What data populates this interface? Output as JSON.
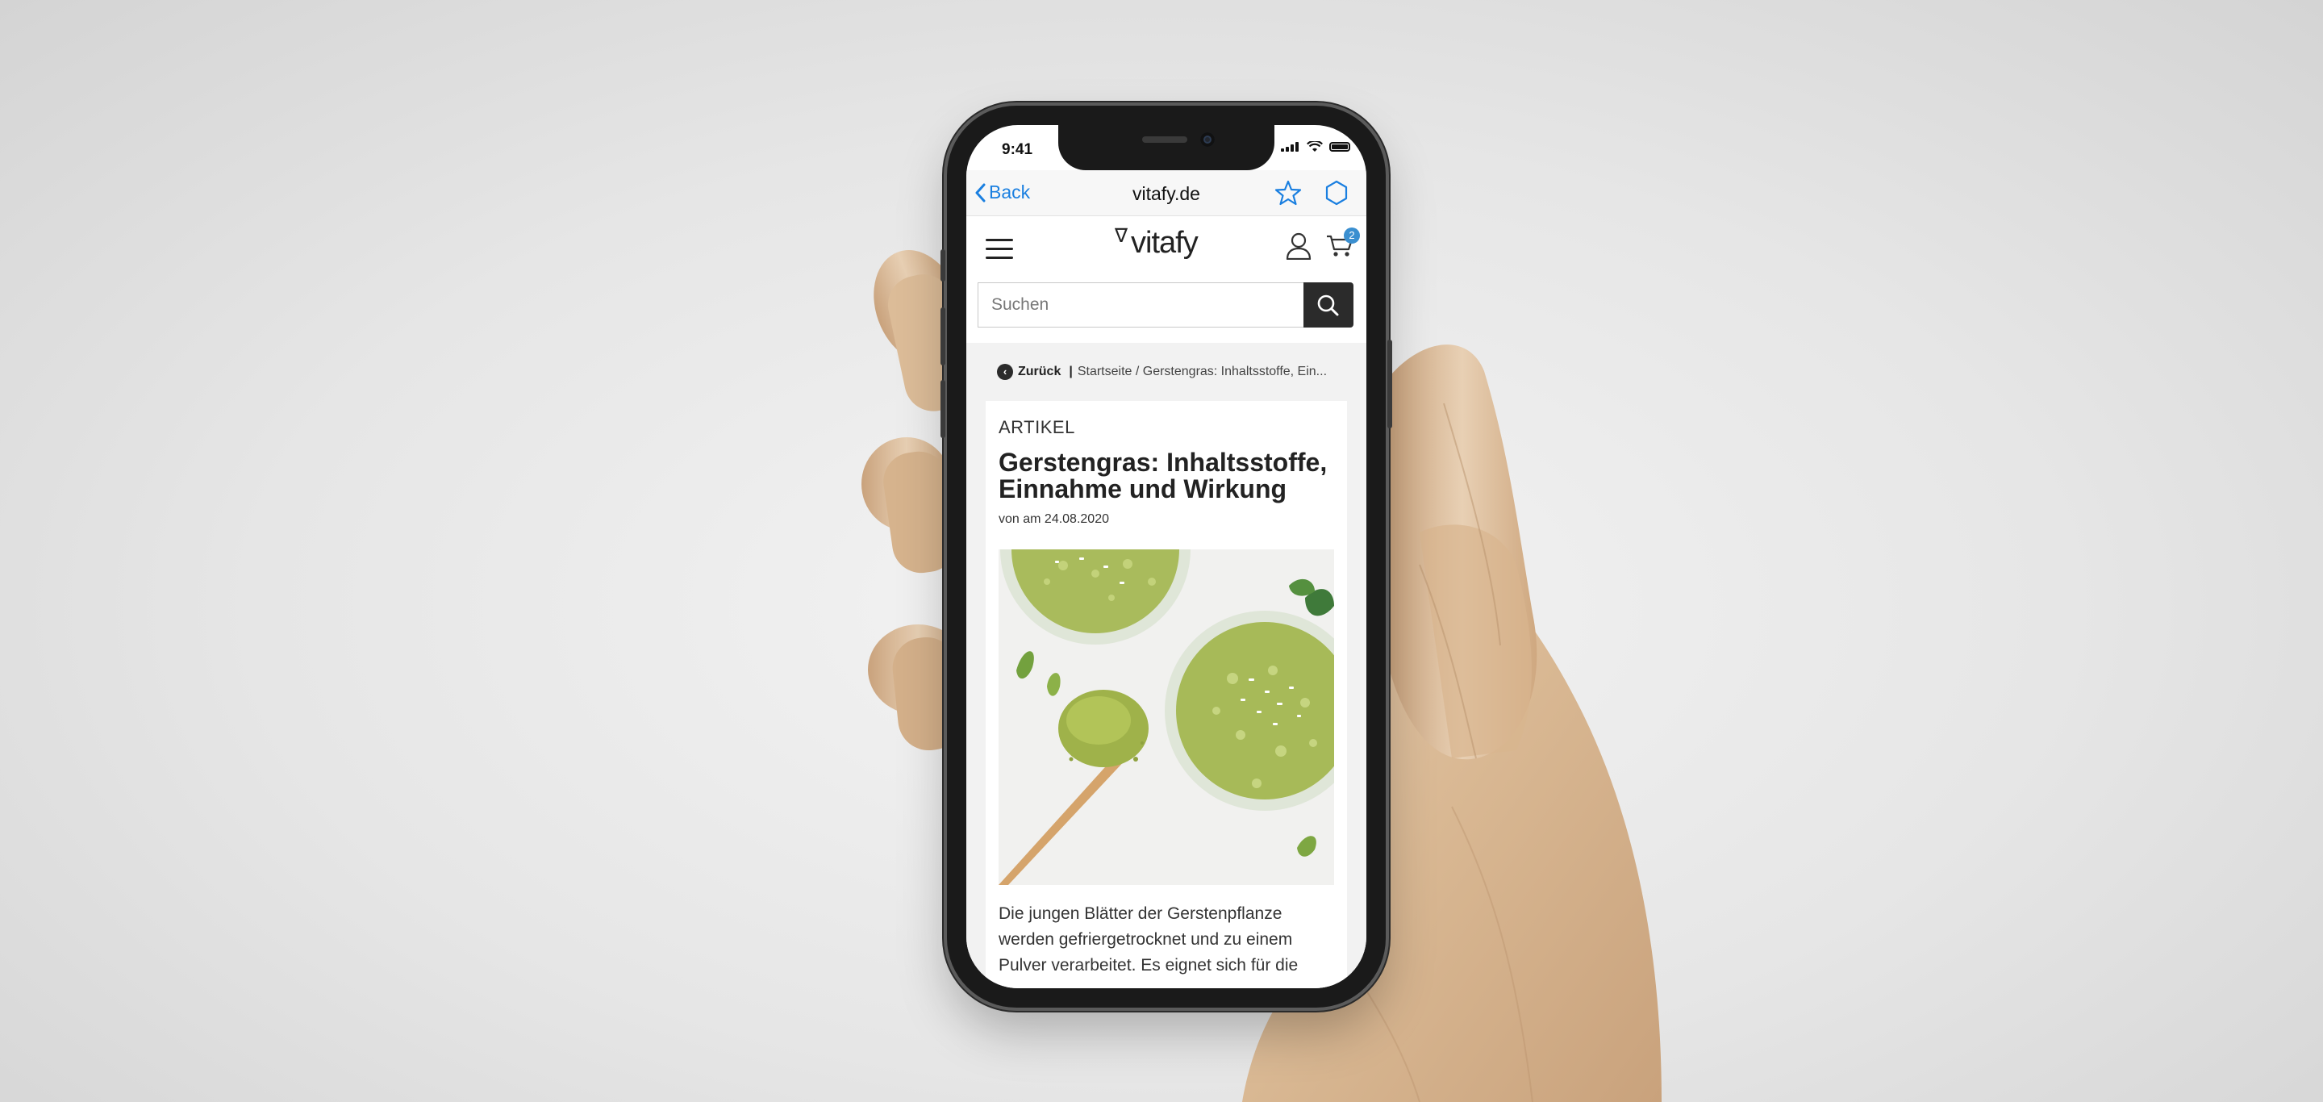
{
  "status_bar": {
    "time": "9:41"
  },
  "browser": {
    "back_label": "Back",
    "title": "vitafy.de"
  },
  "site": {
    "logo_text": "vitafy",
    "cart_count": "2",
    "search": {
      "placeholder": "Suchen"
    }
  },
  "breadcrumb": {
    "back_label": "Zurück",
    "separator": "|",
    "path": "Startseite / Gerstengras: Inhaltsstoffe, Ein..."
  },
  "article": {
    "kicker": "ARTIKEL",
    "title": "Gerstengras: Inhaltsstoffe, Einnahme und Wirkung",
    "meta": "von am 24.08.2020",
    "body": "Die jungen Blätter der Gerstenpflanze werden gefriergetrocknet und zu einem Pulver verarbeitet. Es eignet sich für die"
  },
  "icons": {
    "back": "chevron-left-icon",
    "star": "star-icon",
    "share": "hexagon-icon",
    "menu": "hamburger-icon",
    "user": "user-icon",
    "cart": "cart-icon",
    "search": "search-icon"
  },
  "colors": {
    "ios_blue": "#1a7fe0",
    "dark": "#2b2b2b",
    "badge": "#3a8fd0",
    "matcha_green": "#a8bb5a"
  }
}
